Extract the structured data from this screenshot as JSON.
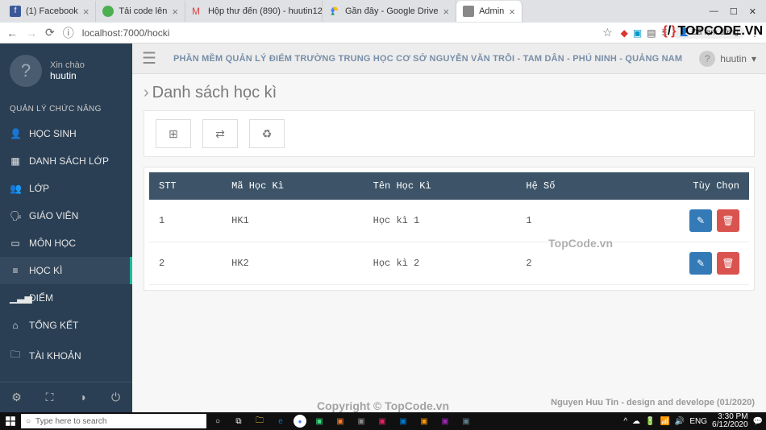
{
  "browser": {
    "tabs": [
      {
        "label": "(1) Facebook"
      },
      {
        "label": "Tải code lên"
      },
      {
        "label": "Hộp thư đến (890) - huutin12..."
      },
      {
        "label": "Gần đây - Google Drive"
      },
      {
        "label": "Admin"
      }
    ],
    "url": "localhost:7000/hocki",
    "paused": "Đã tạm dừng"
  },
  "sidebar": {
    "greeting": "Xin chào",
    "username": "huutin",
    "section": "QUẢN LÝ CHỨC NĂNG",
    "items": [
      {
        "label": "HỌC SINH",
        "icon": "user"
      },
      {
        "label": "DANH SÁCH LỚP",
        "icon": "list"
      },
      {
        "label": "LỚP",
        "icon": "users"
      },
      {
        "label": "GIÁO VIÊN",
        "icon": "teacher"
      },
      {
        "label": "MÔN HỌC",
        "icon": "book"
      },
      {
        "label": "HỌC KÌ",
        "icon": "calendar",
        "active": true
      },
      {
        "label": "ĐIỂM",
        "icon": "chart"
      },
      {
        "label": "TỔNG KẾT",
        "icon": "home"
      },
      {
        "label": "TÀI KHOẢN",
        "icon": "account"
      }
    ]
  },
  "topbar": {
    "app_title": "PHẦN MỀM QUẢN LÝ ĐIỂM TRƯỜNG TRUNG HỌC CƠ SỞ NGUYỄN VĂN TRỖI - TAM DÂN - PHÚ NINH - QUẢNG NAM",
    "user": "huutin"
  },
  "page": {
    "title": "Danh sách học kì"
  },
  "table": {
    "columns": [
      "STT",
      "Mã Học Kì",
      "Tên Học Kì",
      "Hệ Số",
      "Tùy Chọn"
    ],
    "rows": [
      {
        "stt": "1",
        "ma": "HK1",
        "ten": "Học kì 1",
        "heso": "1"
      },
      {
        "stt": "2",
        "ma": "HK2",
        "ten": "Học kì 2",
        "heso": "2"
      }
    ]
  },
  "footer": {
    "credit": "Nguyen Huu Tin - design and develope (01/2020)"
  },
  "watermark": {
    "logo": "TOPCODE.VN",
    "center": "TopCode.vn",
    "bottom": "Copyright © TopCode.vn"
  },
  "taskbar": {
    "search_placeholder": "Type here to search",
    "lang": "ENG",
    "time": "3:30 PM",
    "date": "6/12/2020"
  }
}
